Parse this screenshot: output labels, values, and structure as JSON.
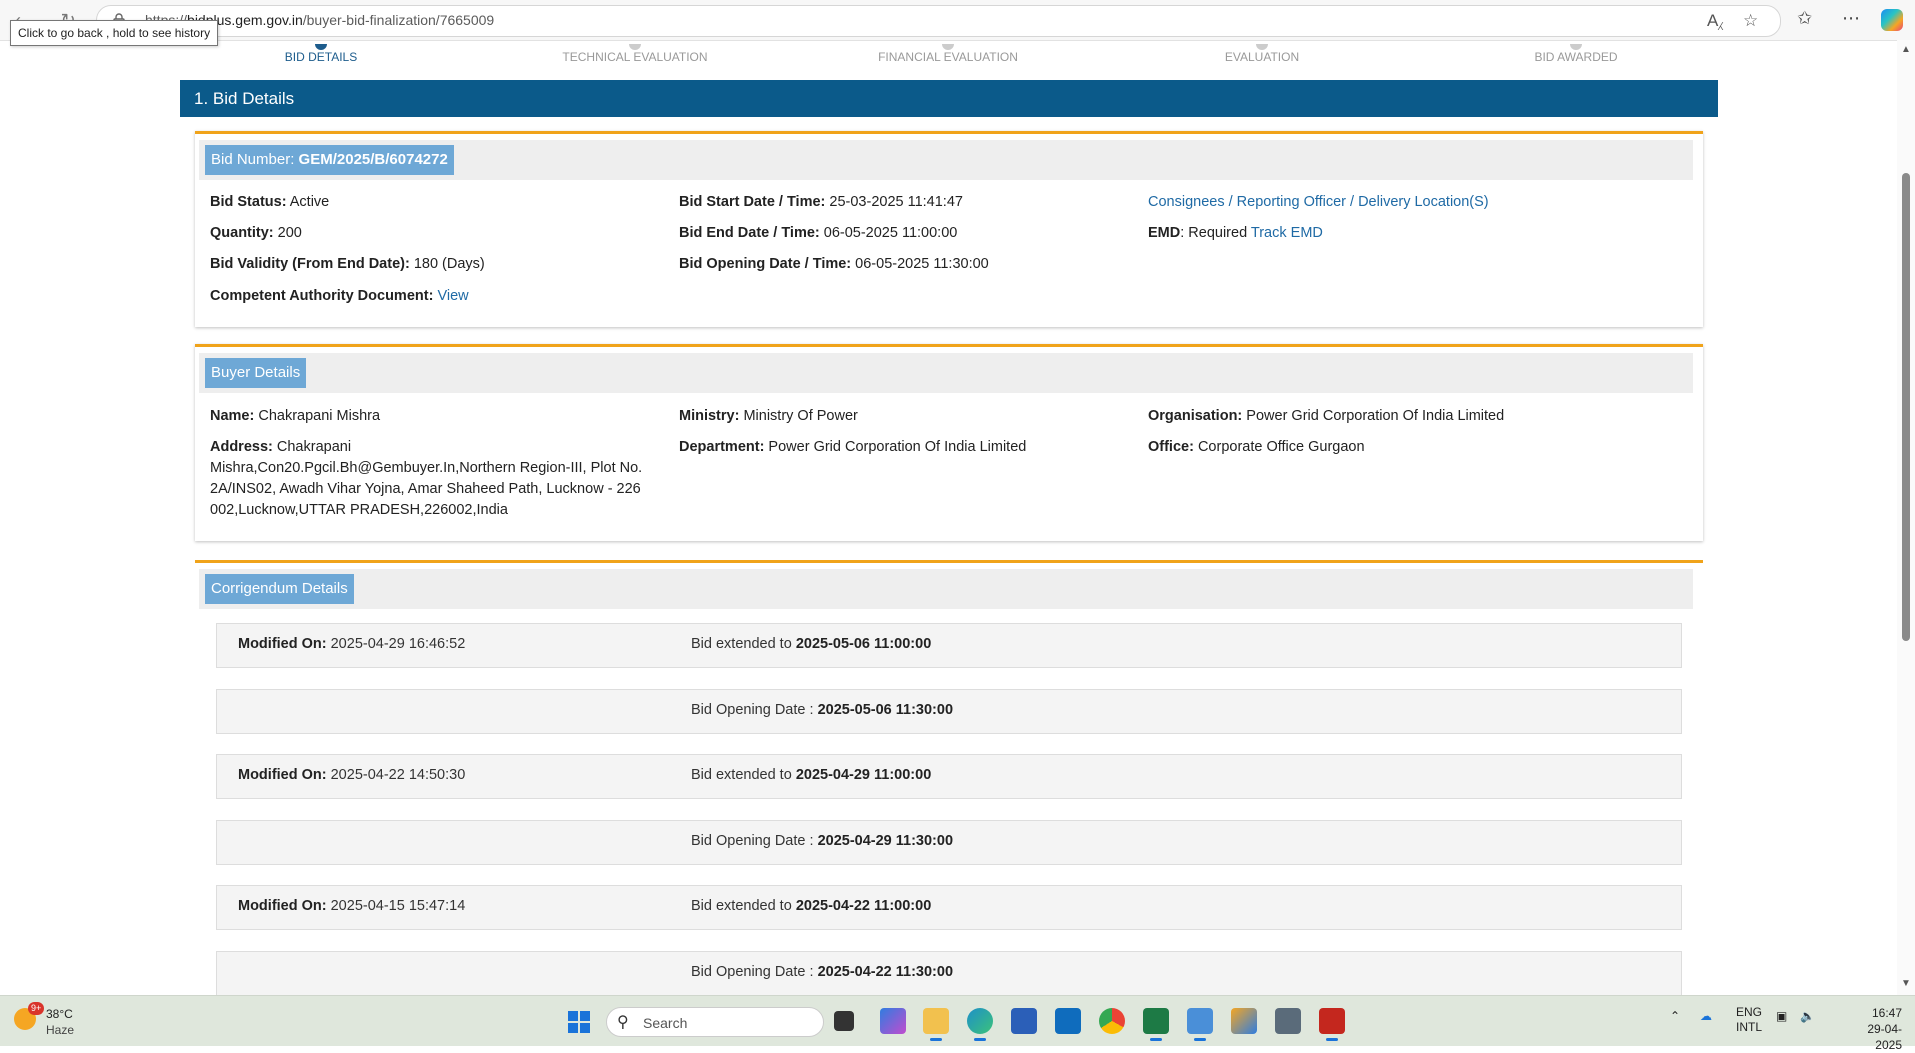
{
  "browser": {
    "url_prefix": "https://",
    "url_domain": "bidplus.gem.gov.in",
    "url_path": "/buyer-bid-finalization/7665009",
    "tooltip": "Click to go back , hold to see history"
  },
  "stepper": {
    "steps": [
      "BID DETAILS",
      "TECHNICAL EVALUATION",
      "FINANCIAL EVALUATION",
      "EVALUATION",
      "BID AWARDED"
    ],
    "active_index": 0
  },
  "section_title": "1. Bid Details",
  "bid": {
    "number_label": "Bid Number: ",
    "number_value": "GEM/2025/B/6074272",
    "status_label": "Bid Status:",
    "status_value": " Active",
    "quantity_label": "Quantity:",
    "quantity_value": " 200",
    "validity_label": "Bid Validity (From End Date):",
    "validity_value": " 180 (Days)",
    "authority_label": "Competent Authority Document:",
    "authority_link": "View",
    "start_label": "Bid Start Date / Time:",
    "start_value": " 25-03-2025 11:41:47",
    "end_label": "Bid End Date / Time:",
    "end_value": " 06-05-2025 11:00:00",
    "opening_label": "Bid Opening Date / Time:",
    "opening_value": " 06-05-2025 11:30:00",
    "consignees_link": "Consignees / Reporting Officer / Delivery Location(S)",
    "emd_label": "EMD",
    "emd_value": ": Required ",
    "emd_link": "Track EMD"
  },
  "buyer": {
    "title": "Buyer Details",
    "name_label": "Name:",
    "name_value": " Chakrapani Mishra",
    "address_label": "Address:",
    "address_value": " Chakrapani Mishra,Con20.Pgcil.Bh@Gembuyer.In,Northern Region-III, Plot No. 2A/INS02, Awadh Vihar Yojna, Amar Shaheed Path, Lucknow - 226 002,Lucknow,UTTAR PRADESH,226002,India",
    "ministry_label": "Ministry:",
    "ministry_value": " Ministry Of Power",
    "department_label": "Department:",
    "department_value": " Power Grid Corporation Of India Limited",
    "organisation_label": "Organisation:",
    "organisation_value": " Power Grid Corporation Of India Limited",
    "office_label": "Office:",
    "office_value": " Corporate Office Gurgaon"
  },
  "corrigendum": {
    "title": "Corrigendum Details",
    "modified_label": "Modified On:",
    "extended_label": "Bid extended to ",
    "opening_label": "Bid Opening Date : ",
    "entries": [
      {
        "modified": " 2025-04-29 16:46:52",
        "extended": "2025-05-06 11:00:00",
        "opening": "2025-05-06 11:30:00"
      },
      {
        "modified": " 2025-04-22 14:50:30",
        "extended": "2025-04-29 11:00:00",
        "opening": "2025-04-29 11:30:00"
      },
      {
        "modified": " 2025-04-15 15:47:14",
        "extended": "2025-04-22 11:00:00",
        "opening": "2025-04-22 11:30:00"
      }
    ]
  },
  "taskbar": {
    "badge": "9+",
    "temperature": "38°C",
    "weather": "Haze",
    "search_label": "Search",
    "lang1": "ENG",
    "lang2": "INTL",
    "time": "16:47",
    "date": "29-04-2025"
  }
}
